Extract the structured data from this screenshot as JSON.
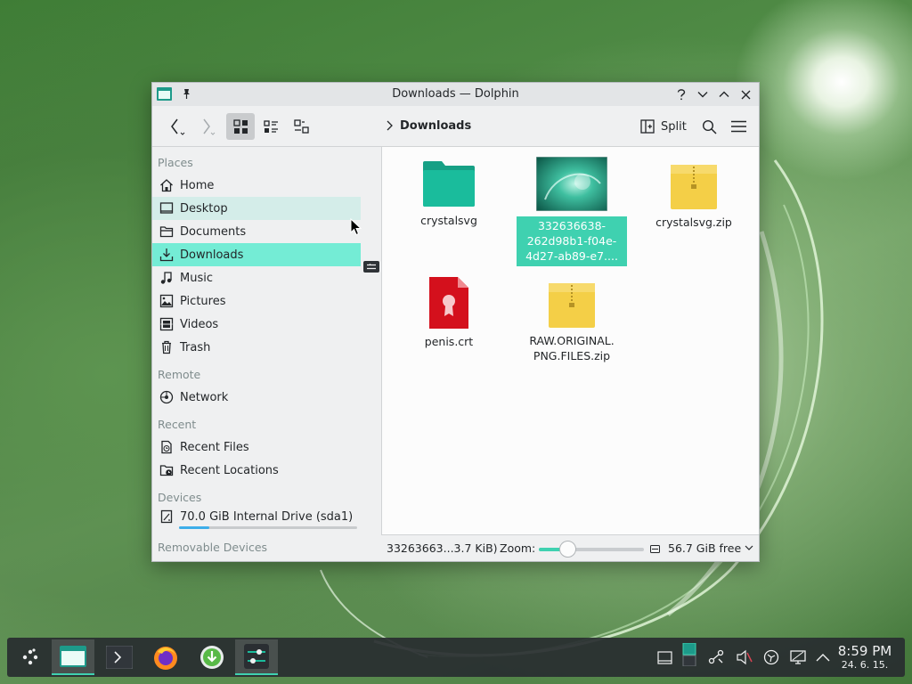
{
  "window": {
    "title": "Downloads — Dolphin",
    "breadcrumb": "Downloads",
    "split_label": "Split"
  },
  "sidebar": {
    "sections": {
      "places": "Places",
      "remote": "Remote",
      "recent": "Recent",
      "devices": "Devices",
      "removable": "Removable Devices"
    },
    "places": [
      {
        "label": "Home",
        "icon": "home-icon"
      },
      {
        "label": "Desktop",
        "icon": "desktop-icon"
      },
      {
        "label": "Documents",
        "icon": "documents-icon"
      },
      {
        "label": "Downloads",
        "icon": "downloads-icon"
      },
      {
        "label": "Music",
        "icon": "music-icon"
      },
      {
        "label": "Pictures",
        "icon": "pictures-icon"
      },
      {
        "label": "Videos",
        "icon": "videos-icon"
      },
      {
        "label": "Trash",
        "icon": "trash-icon"
      }
    ],
    "remote": [
      {
        "label": "Network",
        "icon": "network-icon"
      }
    ],
    "recent": [
      {
        "label": "Recent Files",
        "icon": "recent-files-icon"
      },
      {
        "label": "Recent Locations",
        "icon": "recent-locations-icon"
      }
    ],
    "devices": [
      {
        "label": "70.0 GiB Internal Drive (sda1)",
        "icon": "drive-icon",
        "usage_fraction": 0.17
      }
    ]
  },
  "files": [
    {
      "name": "crystalsvg",
      "type": "folder"
    },
    {
      "name": "332636638-262d98b1-f04e-4d27-ab89-e7....",
      "type": "image",
      "selected": true
    },
    {
      "name": "crystalsvg.zip",
      "type": "zip"
    },
    {
      "name": "penis.crt",
      "type": "certificate"
    },
    {
      "name": "RAW.ORIGINAL.PNG.FILES.zip",
      "type": "zip"
    }
  ],
  "file_labels": {
    "f2_line1": "332636638-",
    "f2_line2": "262d98b1-f04e-",
    "f2_line3": "4d27-ab89-e7....",
    "f5_line1": "RAW.ORIGINAL.",
    "f5_line2": "PNG.FILES.zip"
  },
  "statusbar": {
    "file_info": "33263663...3.7 KiB)",
    "zoom_label": "Zoom:",
    "zoom_fraction": 0.3,
    "free_space": "56.7 GiB free"
  },
  "taskbar": {
    "time": "8:59 PM",
    "date": "24. 6. 15."
  },
  "colors": {
    "accent": "#3fd1b0",
    "active_place": "#74ecd5",
    "hover_place": "#d4ede9"
  }
}
